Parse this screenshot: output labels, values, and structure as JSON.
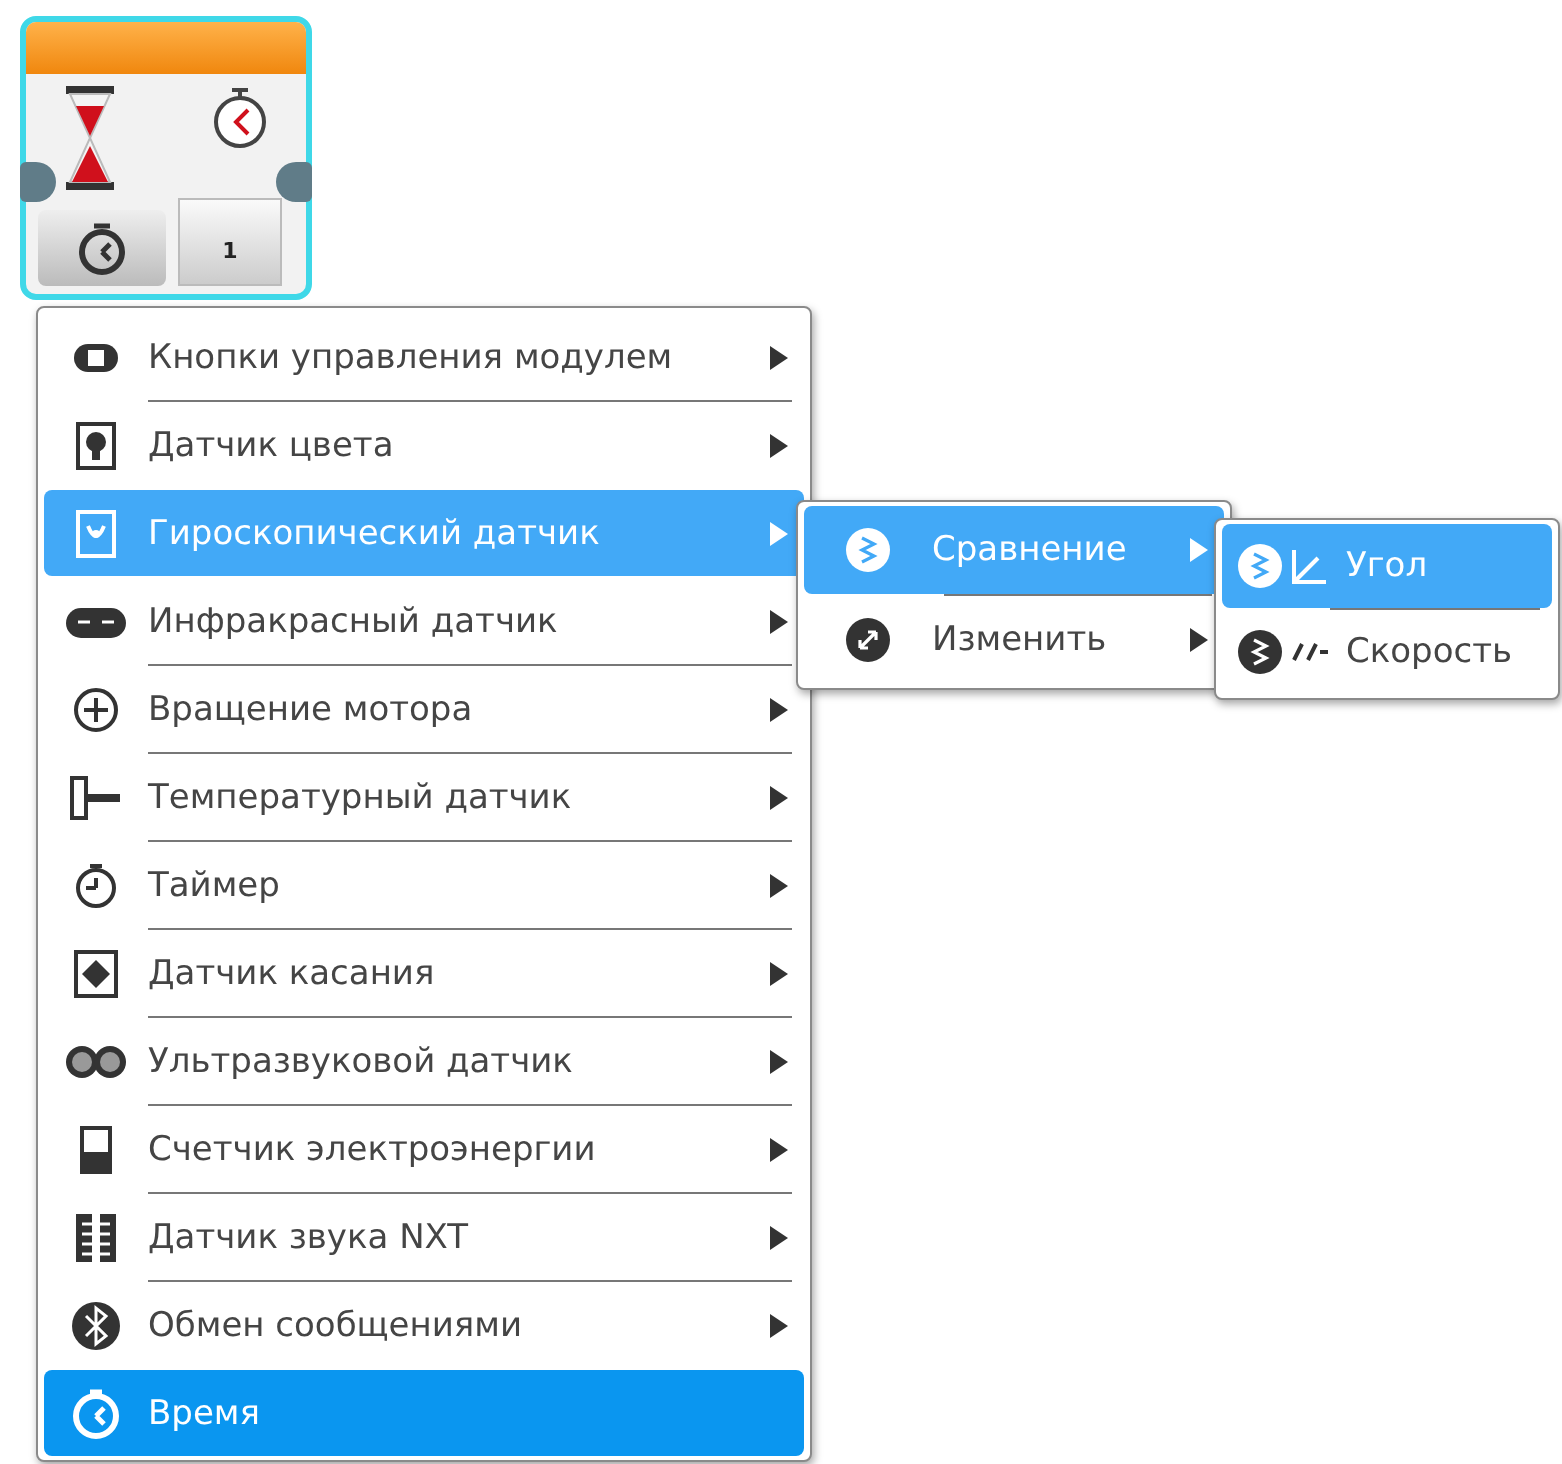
{
  "block": {
    "port_value": "1"
  },
  "menu": {
    "items": [
      {
        "label": "Кнопки управления модулем",
        "has_submenu": true,
        "expanded": false,
        "selected": false
      },
      {
        "label": "Датчик цвета",
        "has_submenu": true,
        "expanded": false,
        "selected": false
      },
      {
        "label": "Гироскопический датчик",
        "has_submenu": true,
        "expanded": true,
        "selected": false
      },
      {
        "label": "Инфракрасный датчик",
        "has_submenu": true,
        "expanded": false,
        "selected": false
      },
      {
        "label": "Вращение мотора",
        "has_submenu": true,
        "expanded": false,
        "selected": false
      },
      {
        "label": "Температурный датчик",
        "has_submenu": true,
        "expanded": false,
        "selected": false
      },
      {
        "label": "Таймер",
        "has_submenu": true,
        "expanded": false,
        "selected": false
      },
      {
        "label": "Датчик касания",
        "has_submenu": true,
        "expanded": false,
        "selected": false
      },
      {
        "label": "Ультразвуковой датчик",
        "has_submenu": true,
        "expanded": false,
        "selected": false
      },
      {
        "label": "Счетчик электроэнергии",
        "has_submenu": true,
        "expanded": false,
        "selected": false
      },
      {
        "label": "Датчик звука NXT",
        "has_submenu": true,
        "expanded": false,
        "selected": false
      },
      {
        "label": "Обмен сообщениями",
        "has_submenu": true,
        "expanded": false,
        "selected": false
      },
      {
        "label": "Время",
        "has_submenu": false,
        "expanded": false,
        "selected": true
      }
    ]
  },
  "submenu": {
    "items": [
      {
        "label": "Сравнение",
        "has_submenu": true,
        "expanded": true
      },
      {
        "label": "Изменить",
        "has_submenu": true,
        "expanded": false
      }
    ]
  },
  "submenu_2": {
    "items": [
      {
        "label": "Угол",
        "highlighted": true
      },
      {
        "label": "Скорость",
        "highlighted": false
      }
    ]
  }
}
